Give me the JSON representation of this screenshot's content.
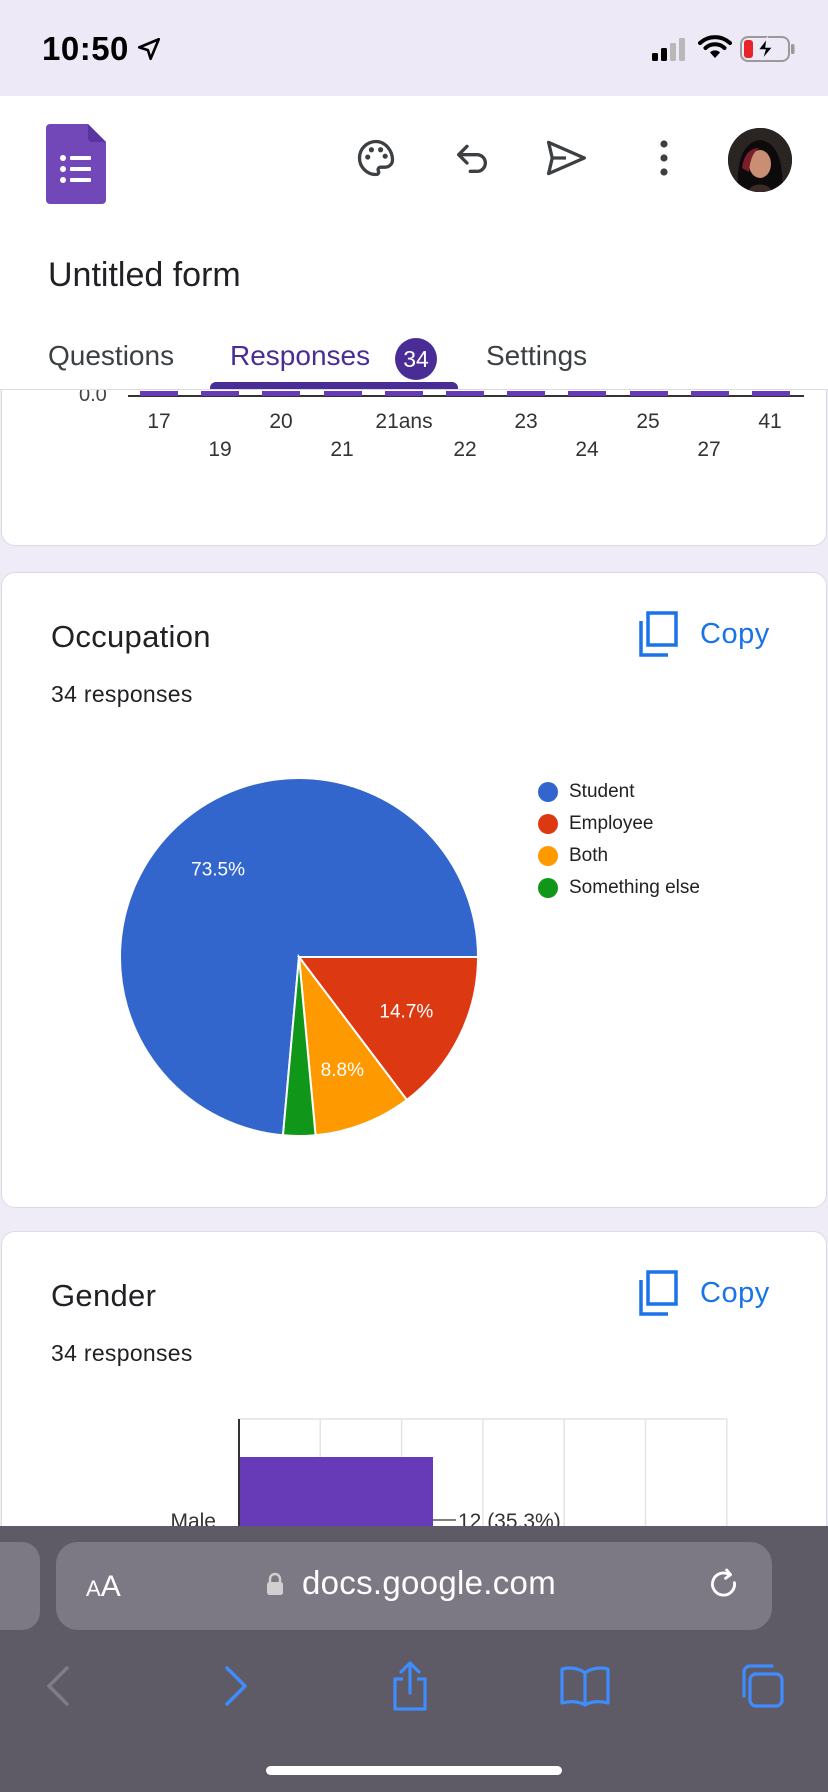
{
  "status_bar": {
    "time": "10:50"
  },
  "header": {
    "form_title": "Untitled form",
    "tabs": [
      {
        "label": "Questions"
      },
      {
        "label": "Responses",
        "badge": "34"
      },
      {
        "label": "Settings"
      }
    ],
    "active_tab": "Responses",
    "accent_color": "#4a2c96"
  },
  "age_chart": {
    "zero_label": "0.0",
    "ticks_top": [
      "17",
      "20",
      "21ans",
      "23",
      "25",
      "41"
    ],
    "ticks_bottom": [
      "19",
      "21",
      "22",
      "24",
      "27"
    ]
  },
  "occupation": {
    "title": "Occupation",
    "responses": "34 responses",
    "copy_label": "Copy"
  },
  "gender": {
    "title": "Gender",
    "responses": "34 responses",
    "copy_label": "Copy",
    "first_bar_label": "Male",
    "first_bar_value": "12 (35.3%)"
  },
  "chart_data": [
    {
      "type": "pie",
      "title": "Occupation",
      "categories": [
        "Student",
        "Employee",
        "Both",
        "Something else"
      ],
      "values": [
        73.5,
        14.7,
        8.8,
        2.9
      ],
      "labels": [
        "73.5%",
        "14.7%",
        "8.8%",
        ""
      ],
      "colors": [
        "#3366cc",
        "#dc3912",
        "#ff9900",
        "#109618"
      ],
      "legend": "right"
    },
    {
      "type": "bar",
      "title": "Gender",
      "orientation": "horizontal",
      "categories": [
        "Male"
      ],
      "values": [
        12
      ],
      "data_labels": [
        "12 (35.3%)"
      ],
      "color": "#673ab7",
      "grid": true
    }
  ],
  "safari": {
    "text_size_small": "A",
    "text_size_large": "A",
    "url": "docs.google.com"
  }
}
